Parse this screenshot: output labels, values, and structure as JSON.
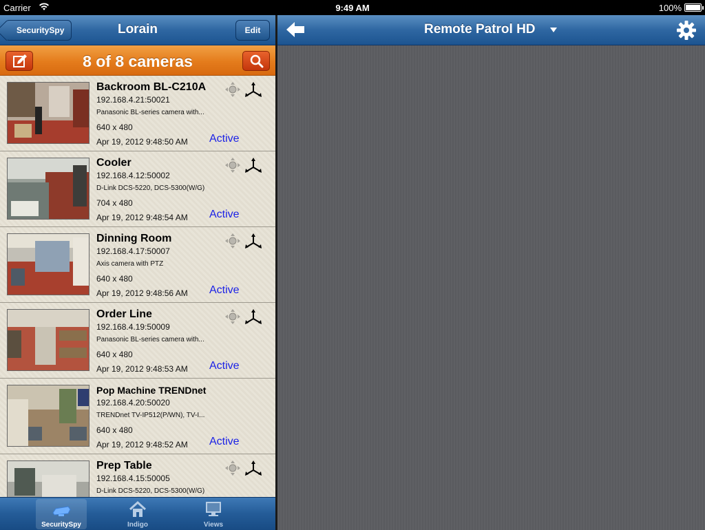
{
  "status_bar": {
    "carrier": "Carrier",
    "time": "9:49 AM",
    "battery": "100%"
  },
  "left_nav": {
    "back_label": "SecuritySpy",
    "title": "Lorain",
    "edit_label": "Edit"
  },
  "camera_bar": {
    "title": "8 of 8 cameras"
  },
  "cameras": [
    {
      "name": "Backroom BL-C210A",
      "ip": "192.168.4.21:50021",
      "model": "Panasonic BL-series camera with...",
      "resolution": "640 x 480",
      "date": "Apr 19, 2012 9:48:50 AM",
      "status": "Active"
    },
    {
      "name": "Cooler",
      "ip": "192.168.4.12:50002",
      "model": "D-Link DCS-5220, DCS-5300(W/G)",
      "resolution": "704 x 480",
      "date": "Apr 19, 2012 9:48:54 AM",
      "status": "Active"
    },
    {
      "name": "Dinning Room",
      "ip": "192.168.4.17:50007",
      "model": "Axis camera with PTZ",
      "resolution": "640 x 480",
      "date": "Apr 19, 2012 9:48:56 AM",
      "status": "Active"
    },
    {
      "name": "Order Line",
      "ip": "192.168.4.19:50009",
      "model": "Panasonic BL-series camera with...",
      "resolution": "640 x 480",
      "date": "Apr 19, 2012 9:48:53 AM",
      "status": "Active"
    },
    {
      "name": "Pop Machine TRENDnet",
      "ip": "192.168.4.20:50020",
      "model": "TRENDnet TV-IP512(P/WN), TV-I...",
      "resolution": "640 x 480",
      "date": "Apr 19, 2012 9:48:52 AM",
      "status": "Active"
    },
    {
      "name": "Prep Table",
      "ip": "192.168.4.15:50005",
      "model": "D-Link DCS-5220, DCS-5300(W/G)",
      "resolution": "",
      "date": "",
      "status": ""
    }
  ],
  "tabs": [
    {
      "label": "SecuritySpy",
      "icon": "camera-icon",
      "active": true
    },
    {
      "label": "Indigo",
      "icon": "house-icon",
      "active": false
    },
    {
      "label": "Views",
      "icon": "monitor-icon",
      "active": false
    }
  ],
  "right_nav": {
    "title": "Remote Patrol HD"
  },
  "colors": {
    "nav_blue": "#2f67a2",
    "orange": "#e47c1c",
    "active_text": "#1a20e6",
    "right_bg": "#5c5d61"
  }
}
